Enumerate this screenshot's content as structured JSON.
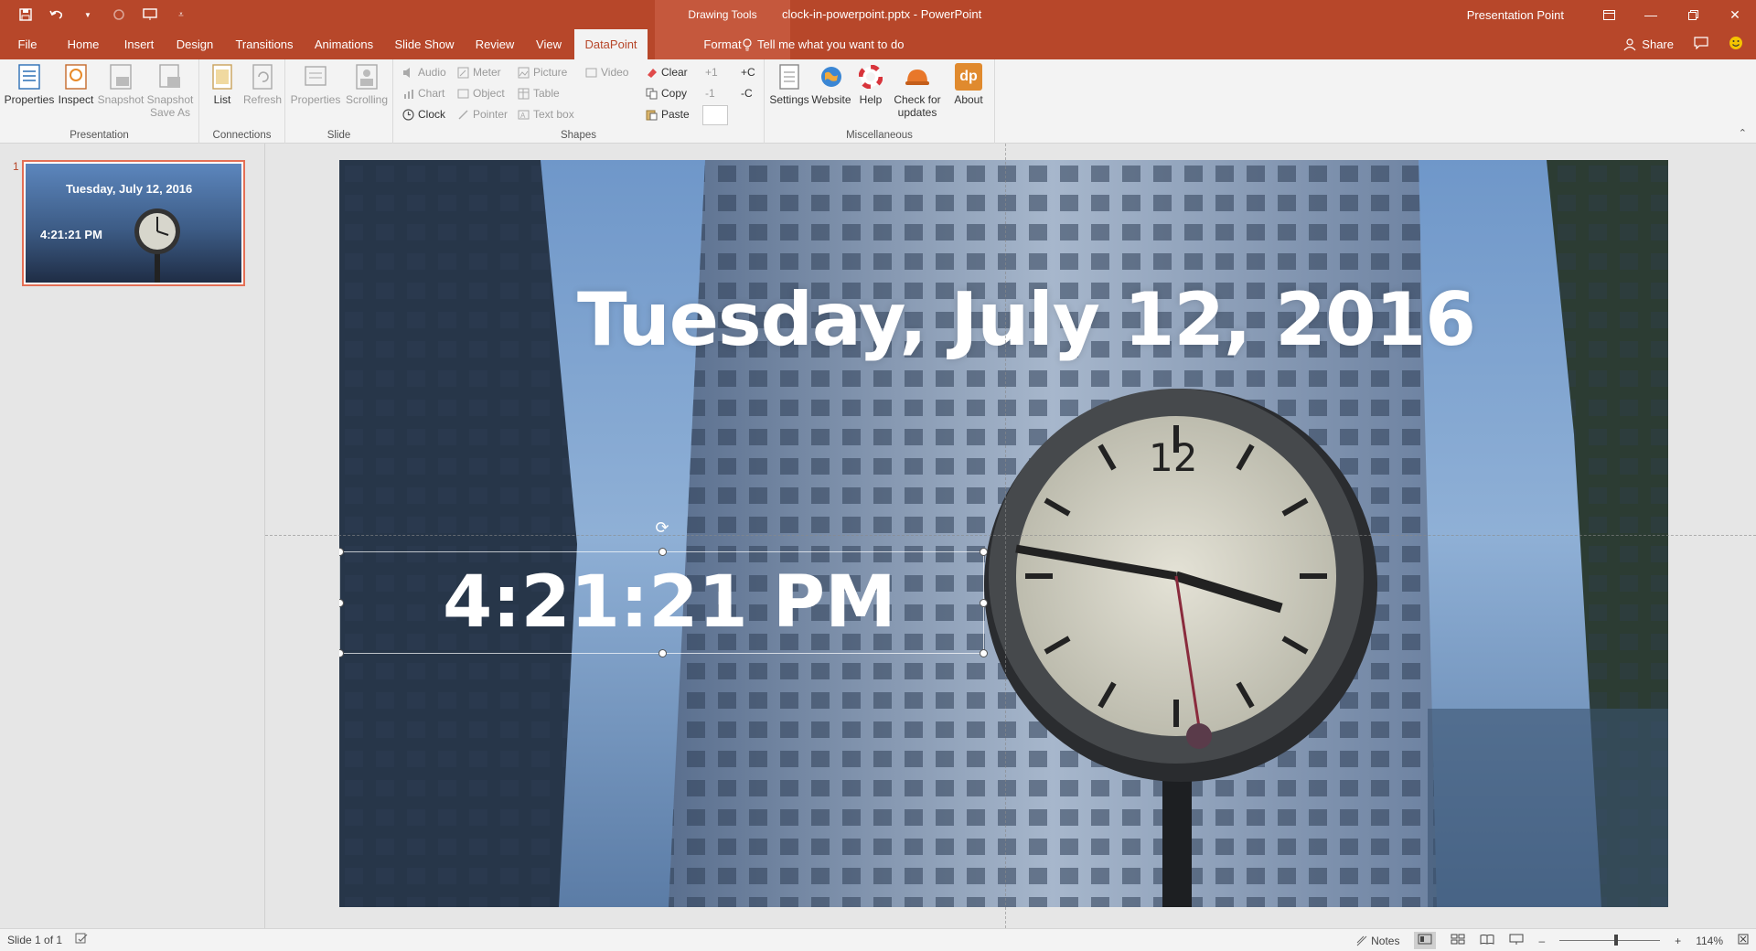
{
  "titlebar": {
    "context_group": "Drawing Tools",
    "document_title": "clock-in-powerpoint.pptx - PowerPoint",
    "user": "Presentation Point"
  },
  "tabs": [
    {
      "label": "File"
    },
    {
      "label": "Home"
    },
    {
      "label": "Insert"
    },
    {
      "label": "Design"
    },
    {
      "label": "Transitions"
    },
    {
      "label": "Animations"
    },
    {
      "label": "Slide Show"
    },
    {
      "label": "Review"
    },
    {
      "label": "View"
    },
    {
      "label": "DataPoint"
    },
    {
      "label": "Format"
    }
  ],
  "tell_me": "Tell me what you want to do",
  "share": "Share",
  "ribbon": {
    "presentation": {
      "label": "Presentation",
      "properties": "Properties",
      "inspect": "Inspect",
      "snapshot": "Snapshot",
      "snapshot_save_as_1": "Snapshot",
      "snapshot_save_as_2": "Save As"
    },
    "connections": {
      "label": "Connections",
      "list": "List",
      "refresh": "Refresh"
    },
    "slide": {
      "label": "Slide",
      "properties": "Properties",
      "scrolling": "Scrolling"
    },
    "shapes": {
      "label": "Shapes",
      "audio": "Audio",
      "meter": "Meter",
      "picture": "Picture",
      "video": "Video",
      "chart": "Chart",
      "object": "Object",
      "table": "Table",
      "clock": "Clock",
      "pointer": "Pointer",
      "textbox": "Text box",
      "clear": "Clear",
      "copy": "Copy",
      "paste": "Paste",
      "plus1": "+1",
      "minus1": "-1",
      "plusC": "+C",
      "minusC": "-C"
    },
    "misc": {
      "label": "Miscellaneous",
      "settings": "Settings",
      "website": "Website",
      "help": "Help",
      "check_1": "Check for",
      "check_2": "updates",
      "about": "About",
      "about_logo": "dp"
    }
  },
  "thumbnails": [
    {
      "number": "1",
      "date": "Tuesday, July 12, 2016",
      "time": "4:21:21 PM"
    }
  ],
  "slide": {
    "date_text": "Tuesday, July 12, 2016",
    "time_text": "4:21:21 PM",
    "clock_numeral": "12"
  },
  "status": {
    "slide_info": "Slide 1 of 1",
    "notes": "Notes",
    "zoom": "114%"
  },
  "colors": {
    "accent": "#b7472a",
    "ribbon_bg": "#f3f3f3",
    "workspace": "#e6e6e6"
  }
}
